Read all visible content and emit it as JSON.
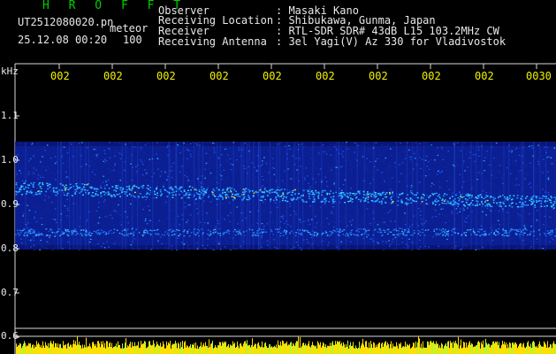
{
  "header": {
    "title": "H R O F F T",
    "filename": "UT2512080020.pn",
    "meteor_label": "meteor",
    "date_time": "25.12.08 00:20",
    "count": "100",
    "info": [
      {
        "label": "Observer",
        "value": ": Masaki Kano"
      },
      {
        "label": "Receiving Location",
        "value": ": Shibukawa, Gunma, Japan"
      },
      {
        "label": "Receiver",
        "value": ": RTL-SDR SDR# 43dB L15 103.2MHz CW"
      },
      {
        "label": "Receiving Antenna",
        "value": ": 3el Yagi(V) Az 330 for Vladivostok"
      }
    ]
  },
  "x_axis": {
    "tick_labels": [
      "002",
      "002",
      "002",
      "002",
      "002",
      "002",
      "002",
      "002",
      "002",
      "0030"
    ]
  },
  "y_axis": {
    "unit": "kHz",
    "tick_labels": [
      "1.1",
      "1.0",
      "0.9",
      "0.8",
      "0.7",
      "0.6"
    ]
  },
  "colors": {
    "background": "#000000",
    "band": "#0a1a8c",
    "signal": "#2aa8ff",
    "hot": "#ffe000",
    "title": "#00d000",
    "text": "#e8e8e8",
    "ticks": "#f2f200"
  }
}
